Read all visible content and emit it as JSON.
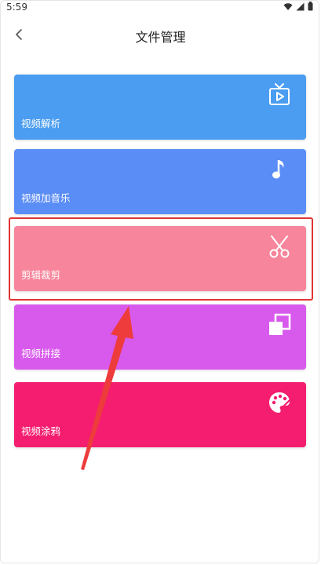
{
  "status_bar": {
    "time": "5:59",
    "icons": [
      "wifi-icon",
      "signal-icon",
      "battery-icon"
    ]
  },
  "header": {
    "title": "文件管理",
    "back_icon": "chevron-left-icon"
  },
  "cards": [
    {
      "label": "视频解析",
      "icon": "tv-play-icon",
      "color": "#4A9DF0"
    },
    {
      "label": "视频加音乐",
      "icon": "music-note-icon",
      "color": "#5A8DF5"
    },
    {
      "label": "剪辑裁剪",
      "icon": "scissors-icon",
      "color": "#F7859B"
    },
    {
      "label": "视频拼接",
      "icon": "copy-squares-icon",
      "color": "#D85AEC"
    },
    {
      "label": "视频涂鸦",
      "icon": "palette-icon",
      "color": "#F51D6F"
    }
  ],
  "annotation": {
    "highlight_color": "#E03434",
    "highlighted_card": "剪辑裁剪"
  }
}
